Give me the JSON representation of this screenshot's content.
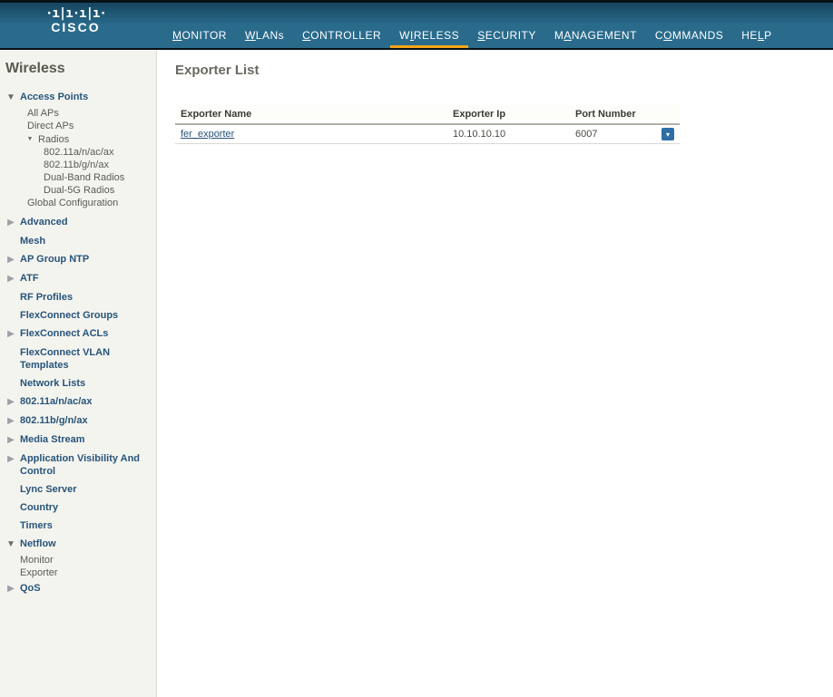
{
  "brand": "CISCO",
  "mainnav": [
    {
      "label": "MONITOR",
      "hotkey": "M"
    },
    {
      "label": "WLANs",
      "hotkey": "W"
    },
    {
      "label": "CONTROLLER",
      "hotkey": "C"
    },
    {
      "label": "WIRELESS",
      "hotkey": "I",
      "active": true
    },
    {
      "label": "SECURITY",
      "hotkey": "S"
    },
    {
      "label": "MANAGEMENT",
      "hotkey": "A"
    },
    {
      "label": "COMMANDS",
      "hotkey": "O"
    },
    {
      "label": "HELP",
      "hotkey": "L"
    }
  ],
  "sidebar": {
    "title": "Wireless",
    "access_points": {
      "label": "Access Points",
      "items": [
        "All APs",
        "Direct APs"
      ],
      "radios": {
        "label": "Radios",
        "items": [
          "802.11a/n/ac/ax",
          "802.11b/g/n/ax",
          "Dual-Band Radios",
          "Dual-5G Radios"
        ]
      },
      "global_config": "Global Configuration"
    },
    "advanced": "Advanced",
    "mesh": "Mesh",
    "ap_group_ntp": "AP Group NTP",
    "atf": "ATF",
    "rf_profiles": "RF Profiles",
    "flexconnect_groups": "FlexConnect Groups",
    "flexconnect_acls": "FlexConnect ACLs",
    "flexconnect_vlan": "FlexConnect VLAN Templates",
    "network_lists": "Network Lists",
    "b80211a": "802.11a/n/ac/ax",
    "b80211b": "802.11b/g/n/ax",
    "media_stream": "Media Stream",
    "avc": "Application Visibility And Control",
    "lync": "Lync Server",
    "country": "Country",
    "timers": "Timers",
    "netflow": {
      "label": "Netflow",
      "items": [
        "Monitor",
        "Exporter"
      ]
    },
    "qos": "QoS"
  },
  "page": {
    "title": "Exporter List",
    "columns": [
      "Exporter Name",
      "Exporter Ip",
      "Port Number"
    ],
    "rows": [
      {
        "name": "fer_exporter",
        "ip": "10.10.10.10",
        "port": "6007"
      }
    ]
  }
}
